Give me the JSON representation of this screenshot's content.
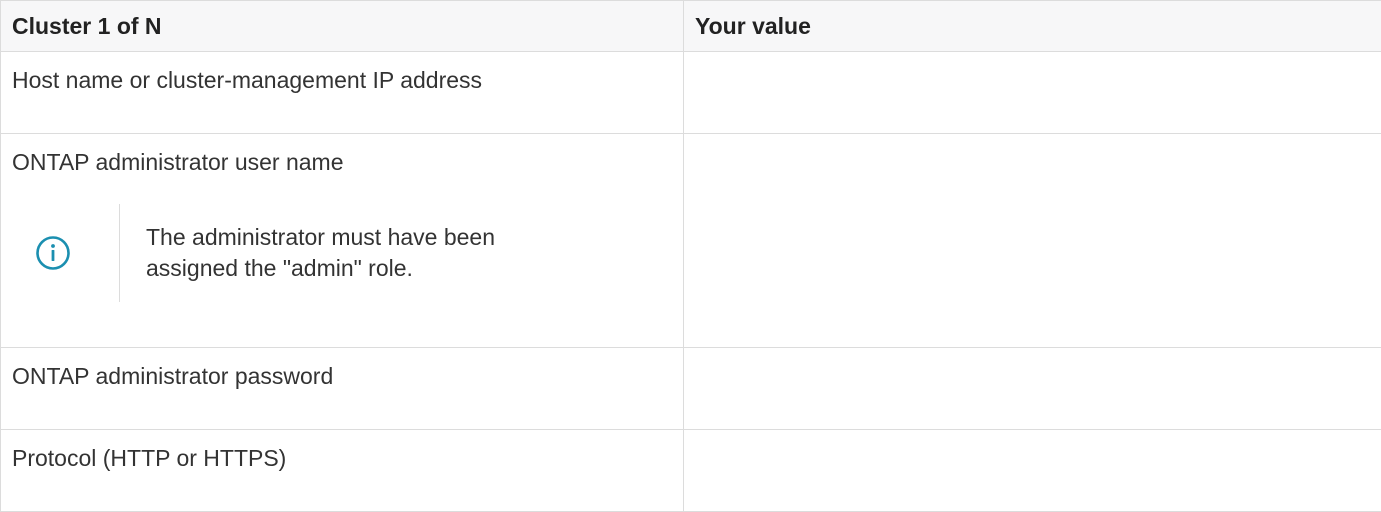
{
  "table": {
    "headers": {
      "label": "Cluster 1 of N",
      "value": "Your value"
    },
    "rows": [
      {
        "label": "Host name or cluster-management IP address",
        "value": ""
      },
      {
        "label": "ONTAP administrator user name",
        "value": "",
        "note": {
          "icon": "info-icon",
          "text_line1": "The administrator must have been",
          "text_line2": "assigned the \"admin\" role."
        }
      },
      {
        "label": "ONTAP administrator password",
        "value": ""
      },
      {
        "label": "Protocol (HTTP or HTTPS)",
        "value": ""
      }
    ]
  },
  "colors": {
    "border": "#dcdcdc",
    "header_bg": "#f7f7f8",
    "info_icon": "#1b8fb0",
    "text": "#333333"
  }
}
